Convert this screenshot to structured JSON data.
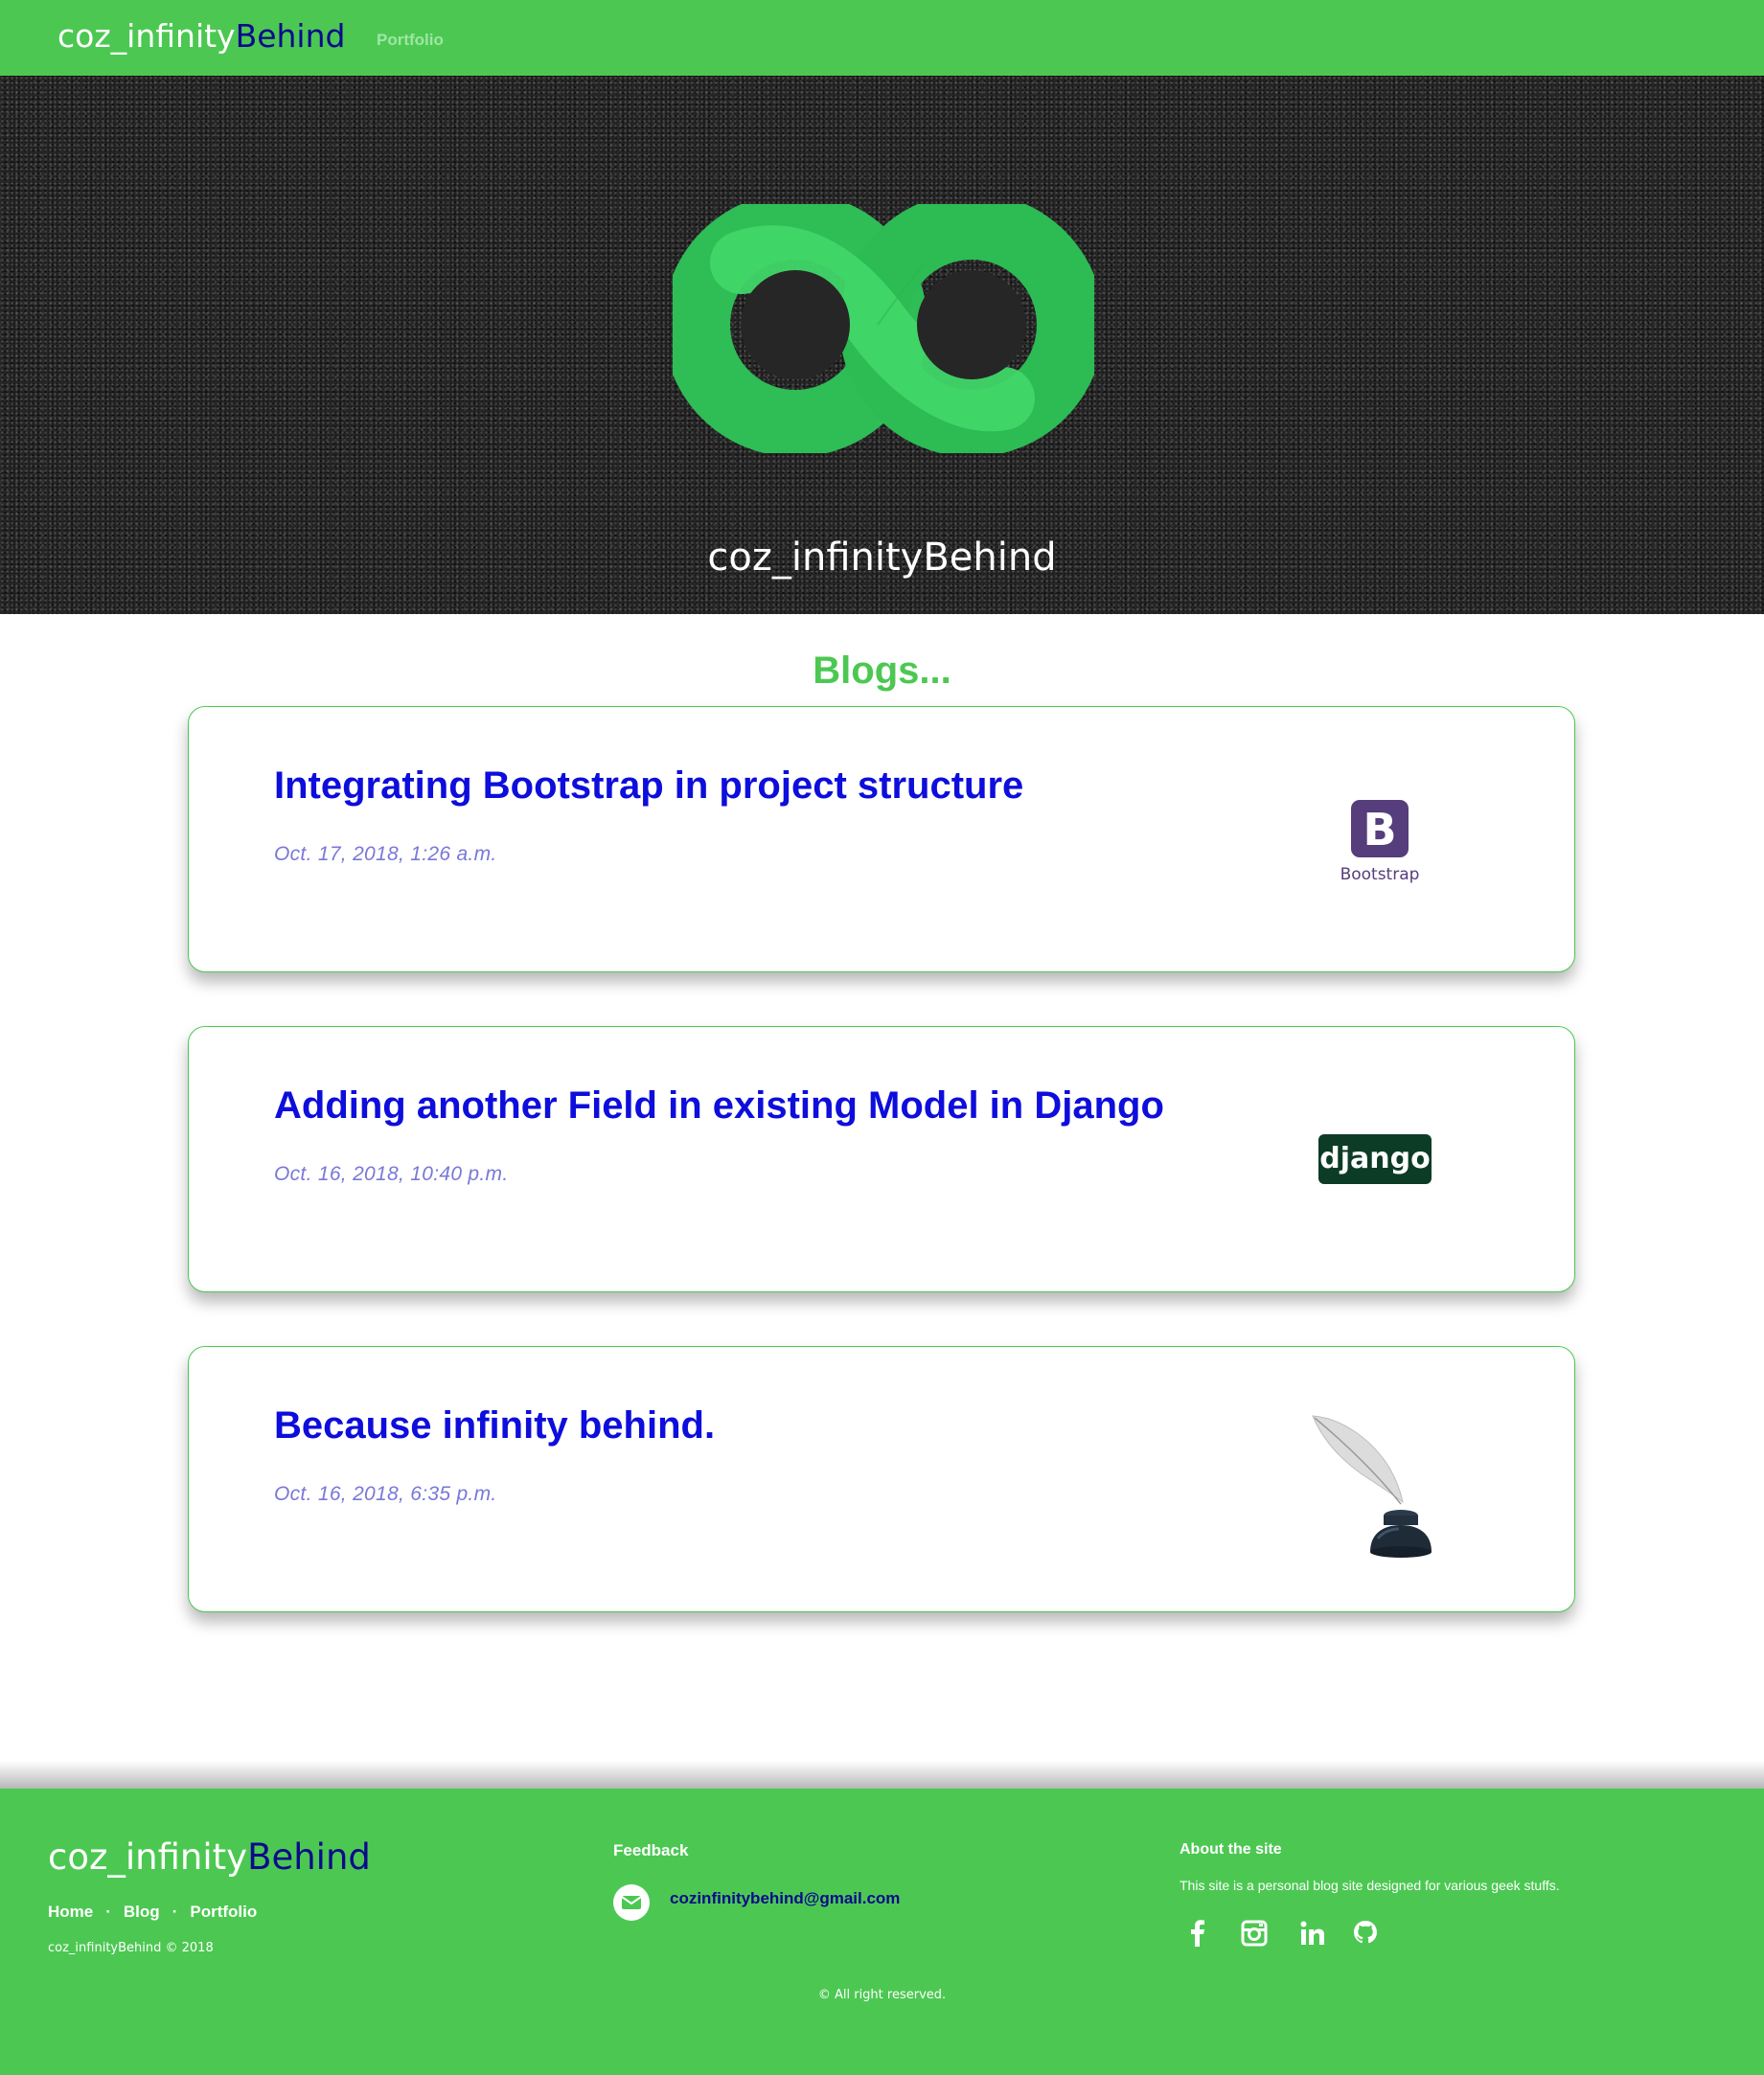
{
  "nav": {
    "brand_part1": "coz_infinity",
    "brand_part2": "Behind",
    "links": [
      {
        "label": "Portfolio"
      }
    ]
  },
  "hero": {
    "title": "coz_infinityBehind",
    "logo_icon": "infinity-logo-icon"
  },
  "blogs": {
    "heading": "Blogs...",
    "posts": [
      {
        "title": "Integrating Bootstrap in project structure",
        "date": "Oct. 17, 2018, 1:26 a.m.",
        "thumb_icon": "bootstrap-logo-icon",
        "thumb_letter": "B",
        "thumb_label": "Bootstrap"
      },
      {
        "title": "Adding another Field in existing Model in Django",
        "date": "Oct. 16, 2018, 10:40 p.m.",
        "thumb_icon": "django-logo-icon",
        "thumb_label": "django"
      },
      {
        "title": "Because infinity behind.",
        "date": "Oct. 16, 2018, 6:35 p.m.",
        "thumb_icon": "quill-inkpot-icon"
      }
    ]
  },
  "footer": {
    "brand_part1": "coz_infinity",
    "brand_part2": "Behind",
    "links": [
      {
        "label": "Home"
      },
      {
        "label": "Blog"
      },
      {
        "label": "Portfolio"
      }
    ],
    "separator": "·",
    "copyright": "coz_infinityBehind © 2018",
    "feedback": {
      "title": "Feedback",
      "email": "cozinfinitybehind@gmail.com",
      "icon": "envelope-icon"
    },
    "about": {
      "title": "About the site",
      "text": "This site is a personal blog site designed for various geek stuffs."
    },
    "social_icons": [
      "facebook-icon",
      "instagram-icon",
      "linkedin-icon",
      "github-icon"
    ],
    "rights": "© All right reserved."
  },
  "colors": {
    "brand_green": "#4cc852",
    "brand_navy": "#0a0a8c",
    "post_title_blue": "#0d0ddc",
    "post_date": "#7878d8",
    "bootstrap_purple": "#563d7c",
    "django_green": "#0c3c26"
  }
}
